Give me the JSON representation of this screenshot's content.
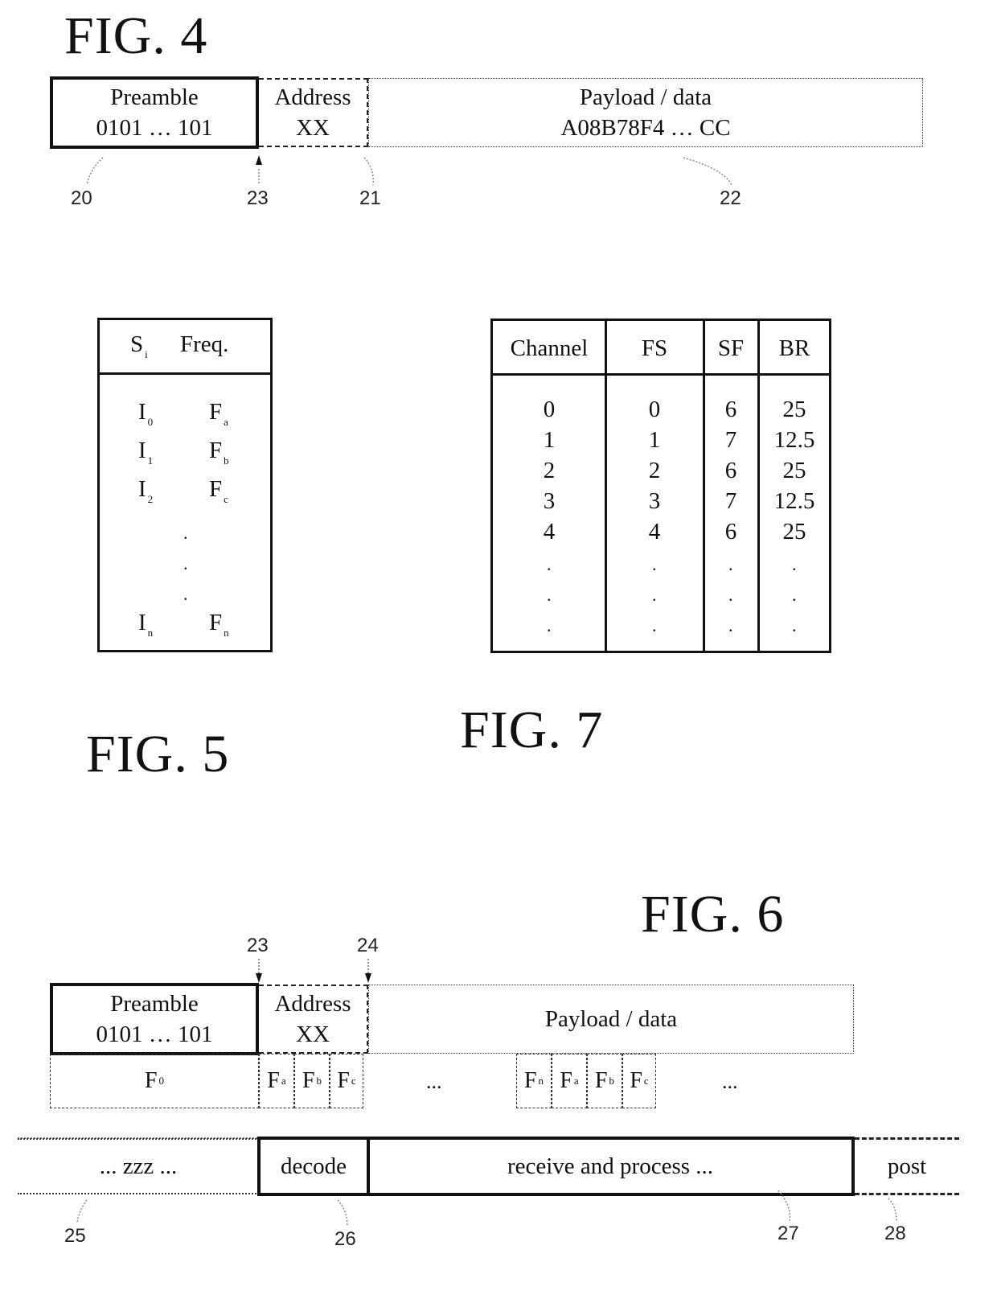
{
  "fig4": {
    "title": "FIG. 4",
    "preamble": {
      "label": "Preamble",
      "value": "0101 … 101"
    },
    "address": {
      "label": "Address",
      "value": "XX"
    },
    "payload": {
      "label": "Payload / data",
      "value": "A08B78F4 … CC"
    },
    "refs": {
      "preamble": "20",
      "boundary": "23",
      "address": "21",
      "payload": "22"
    }
  },
  "fig5": {
    "title": "FIG. 5",
    "headers": {
      "symbol": "S",
      "symbol_sub": "i",
      "freq": "Freq."
    },
    "rows": [
      {
        "s": "I",
        "s_sub": "0",
        "f": "F",
        "f_sub": "a"
      },
      {
        "s": "I",
        "s_sub": "1",
        "f": "F",
        "f_sub": "b"
      },
      {
        "s": "I",
        "s_sub": "2",
        "f": "F",
        "f_sub": "c"
      },
      {
        "s": "I",
        "s_sub": "n",
        "f": "F",
        "f_sub": "n"
      }
    ],
    "ellipsis": "."
  },
  "fig7": {
    "title": "FIG. 7",
    "headers": [
      "Channel",
      "FS",
      "SF",
      "BR"
    ],
    "rows": [
      [
        "0",
        "0",
        "6",
        "25"
      ],
      [
        "1",
        "1",
        "7",
        "12.5"
      ],
      [
        "2",
        "2",
        "6",
        "25"
      ],
      [
        "3",
        "3",
        "7",
        "12.5"
      ],
      [
        "4",
        "4",
        "6",
        "25"
      ]
    ],
    "ellipsis": "."
  },
  "fig6": {
    "title": "FIG. 6",
    "preamble": {
      "label": "Preamble",
      "value": "0101 … 101"
    },
    "address": {
      "label": "Address",
      "value": "XX"
    },
    "payload": {
      "label": "Payload / data"
    },
    "freq_row": {
      "f0": {
        "base": "F",
        "sub": "0"
      },
      "hops1": [
        {
          "base": "F",
          "sub": "a"
        },
        {
          "base": "F",
          "sub": "b"
        },
        {
          "base": "F",
          "sub": "c"
        }
      ],
      "ellipsis1": "...",
      "hops2": [
        {
          "base": "F",
          "sub": "n"
        },
        {
          "base": "F",
          "sub": "a"
        },
        {
          "base": "F",
          "sub": "b"
        },
        {
          "base": "F",
          "sub": "c"
        }
      ],
      "ellipsis2": "..."
    },
    "states": {
      "sleep": "... zzz ...",
      "decode": "decode",
      "receive": "receive and process ...",
      "post": "post"
    },
    "refs": {
      "t23": "23",
      "t24": "24",
      "sleep": "25",
      "decode": "26",
      "receive": "27",
      "post": "28"
    }
  }
}
